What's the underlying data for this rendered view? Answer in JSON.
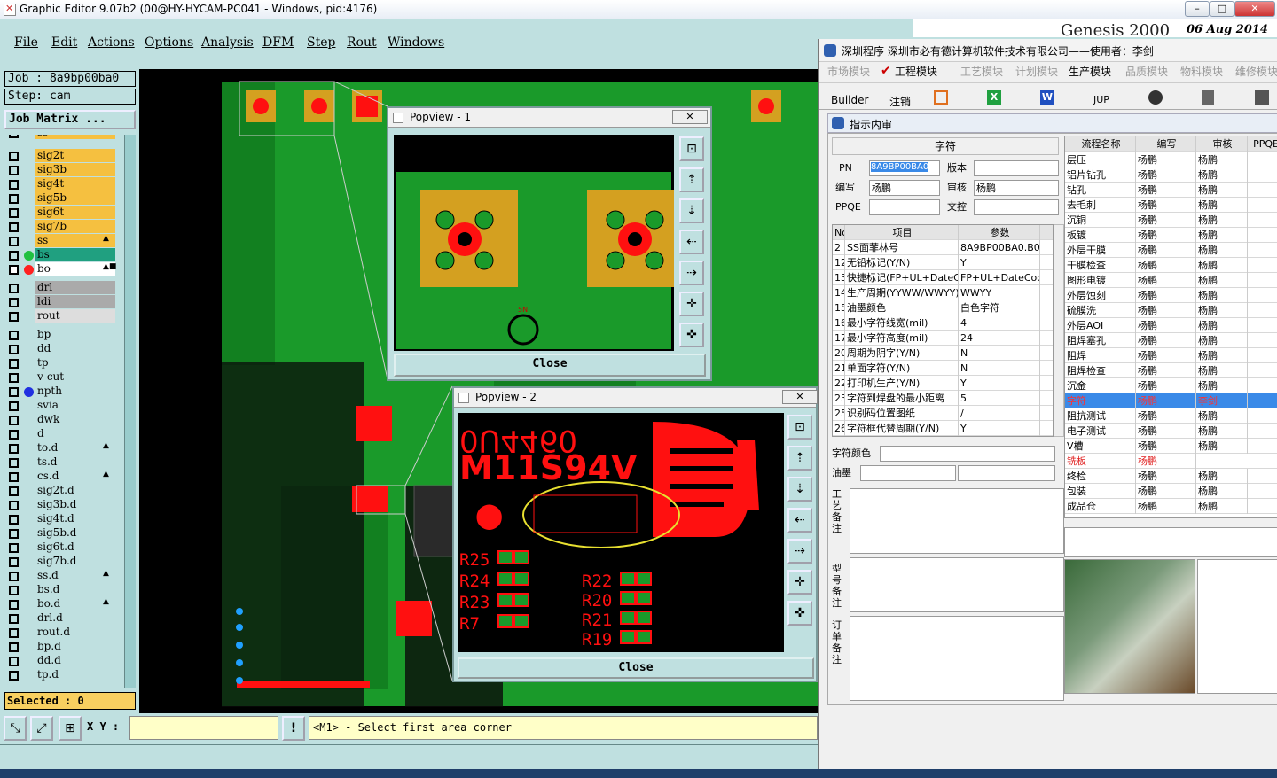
{
  "app": {
    "title": "Graphic Editor 9.07b2 (00@HY-HYCAM-PC041 - Windows, pid:4176)",
    "genesis": "Genesis 2000",
    "date": "06 Aug 2014"
  },
  "menu": [
    "File",
    "Edit",
    "Actions",
    "Options",
    "Analysis",
    "DFM",
    "Step",
    "Rout",
    "Windows"
  ],
  "job": {
    "job": "Job : 8a9bp00ba0",
    "step": "Step: cam",
    "matrix": "Job Matrix ..."
  },
  "layers": [
    {
      "n": "ss",
      "c": "#f5c040",
      "a": "▲"
    },
    {
      "n": "sig2t",
      "c": "#f5c040"
    },
    {
      "n": "sig3b",
      "c": "#f5c040"
    },
    {
      "n": "sig4t",
      "c": "#f5c040"
    },
    {
      "n": "sig5b",
      "c": "#f5c040"
    },
    {
      "n": "sig6t",
      "c": "#f5c040"
    },
    {
      "n": "sig7b",
      "c": "#f5c040"
    },
    {
      "n": "ss",
      "c": "#f5c040",
      "a": "▲"
    },
    {
      "n": "bs",
      "c": "#20a080",
      "dot": "#20c040"
    },
    {
      "n": "bo",
      "c": "#ffffff",
      "dot": "#ff2020",
      "a": "▲■",
      "sel": true
    },
    {
      "n": "drl",
      "c": "#aaa",
      "gap": true
    },
    {
      "n": "ldi",
      "c": "#aaa"
    },
    {
      "n": "rout",
      "c": "#ddd"
    },
    {
      "n": "bp",
      "c": "#bfe0e0",
      "gap": true
    },
    {
      "n": "dd",
      "c": "#bfe0e0"
    },
    {
      "n": "tp",
      "c": "#bfe0e0"
    },
    {
      "n": "v-cut",
      "c": "#bfe0e0"
    },
    {
      "n": "npth",
      "c": "#bfe0e0",
      "dot": "#2030e0"
    },
    {
      "n": "svia",
      "c": "#bfe0e0"
    },
    {
      "n": "dwk",
      "c": "#bfe0e0"
    },
    {
      "n": "d",
      "c": "#bfe0e0"
    },
    {
      "n": "to.d",
      "c": "#bfe0e0",
      "a": "▲"
    },
    {
      "n": "ts.d",
      "c": "#bfe0e0"
    },
    {
      "n": "cs.d",
      "c": "#bfe0e0",
      "a": "▲"
    },
    {
      "n": "sig2t.d",
      "c": "#bfe0e0"
    },
    {
      "n": "sig3b.d",
      "c": "#bfe0e0"
    },
    {
      "n": "sig4t.d",
      "c": "#bfe0e0"
    },
    {
      "n": "sig5b.d",
      "c": "#bfe0e0"
    },
    {
      "n": "sig6t.d",
      "c": "#bfe0e0"
    },
    {
      "n": "sig7b.d",
      "c": "#bfe0e0"
    },
    {
      "n": "ss.d",
      "c": "#bfe0e0",
      "a": "▲"
    },
    {
      "n": "bs.d",
      "c": "#bfe0e0"
    },
    {
      "n": "bo.d",
      "c": "#bfe0e0",
      "a": "▲"
    },
    {
      "n": "drl.d",
      "c": "#bfe0e0"
    },
    {
      "n": "rout.d",
      "c": "#bfe0e0"
    },
    {
      "n": "bp.d",
      "c": "#bfe0e0"
    },
    {
      "n": "dd.d",
      "c": "#bfe0e0"
    },
    {
      "n": "tp.d",
      "c": "#bfe0e0"
    }
  ],
  "selected": "Selected : 0",
  "xy_label": "X Y :",
  "prompt": "<M1> - Select first area corner",
  "popview1": {
    "title": "Popview - 1",
    "close": "Close",
    "mark": "5N"
  },
  "popview2": {
    "title": "Popview - 2",
    "close": "Close",
    "text1": "0U4460",
    "text2": "M11S94V",
    "labels_l": [
      "R25",
      "R24",
      "R23",
      "R7"
    ],
    "labels_r": [
      "R22",
      "R20",
      "R21",
      "R19"
    ]
  },
  "right": {
    "title": "深圳程序   深圳市必有德计算机软件技术有限公司——使用者：李剑",
    "tabs": [
      "市场模块",
      "工程模块",
      "工艺模块",
      "计划模块",
      "生产模块",
      "品质模块",
      "物料模块",
      "维修模块"
    ],
    "toolbar": [
      "Builder",
      "注销",
      "JUP"
    ],
    "subtitle": "指示内审",
    "form": {
      "header": "字符",
      "pn_label": "PN",
      "pn_value": "8A9BP00BA0",
      "ver_label": "版本",
      "ver_value": "",
      "writer_label": "编写",
      "writer_value": "杨鹏",
      "audit_label": "审核",
      "audit_value": "杨鹏",
      "ppqe_label": "PPQE",
      "ppqe_value": "",
      "control_label": "文控",
      "control_value": ""
    },
    "params_hdr": [
      "No",
      "项目",
      "参数"
    ],
    "params": [
      [
        "2",
        "SS面菲林号",
        "8A9BP00BA0.B0"
      ],
      [
        "12",
        "无铅标记(Y/N)",
        "Y"
      ],
      [
        "13",
        "快捷标记(FP+UL+DateCo",
        "FP+UL+DateCode"
      ],
      [
        "14",
        "生产周期(YYWW/WWYY)",
        "WWYY"
      ],
      [
        "15",
        "油墨颜色",
        "白色字符"
      ],
      [
        "16",
        "最小字符线宽(mil)",
        "4"
      ],
      [
        "17",
        "最小字符高度(mil)",
        "24"
      ],
      [
        "20",
        "周期为阴字(Y/N)",
        "N"
      ],
      [
        "21",
        "单面字符(Y/N)",
        "N"
      ],
      [
        "22",
        "打印机生产(Y/N)",
        "Y"
      ],
      [
        "23",
        "字符到焊盘的最小距离",
        "5"
      ],
      [
        "25",
        "识别码位置图纸",
        "/"
      ],
      [
        "26",
        "字符框代替周期(Y/N)",
        "Y"
      ]
    ],
    "color_label": "字符颜色",
    "ink_label": "油墨",
    "notes": [
      "工艺备注",
      "型号备注",
      "订单备注"
    ],
    "flow_hdr": [
      "流程名称",
      "编写",
      "审核",
      "PPQE"
    ],
    "flow": [
      [
        "层压",
        "杨鹏",
        "杨鹏"
      ],
      [
        "铝片钻孔",
        "杨鹏",
        "杨鹏"
      ],
      [
        "钻孔",
        "杨鹏",
        "杨鹏"
      ],
      [
        "去毛刺",
        "杨鹏",
        "杨鹏"
      ],
      [
        "沉铜",
        "杨鹏",
        "杨鹏"
      ],
      [
        "板镀",
        "杨鹏",
        "杨鹏"
      ],
      [
        "外层干膜",
        "杨鹏",
        "杨鹏"
      ],
      [
        "干膜检查",
        "杨鹏",
        "杨鹏"
      ],
      [
        "图形电镀",
        "杨鹏",
        "杨鹏"
      ],
      [
        "外层蚀刻",
        "杨鹏",
        "杨鹏"
      ],
      [
        "硫膜洗",
        "杨鹏",
        "杨鹏"
      ],
      [
        "外层AOI",
        "杨鹏",
        "杨鹏"
      ],
      [
        "阻焊塞孔",
        "杨鹏",
        "杨鹏"
      ],
      [
        "阻焊",
        "杨鹏",
        "杨鹏"
      ],
      [
        "阻焊检查",
        "杨鹏",
        "杨鹏"
      ],
      [
        "沉金",
        "杨鹏",
        "杨鹏"
      ],
      [
        "字符",
        "杨鹏",
        "李剑"
      ],
      [
        "阻抗测试",
        "杨鹏",
        "杨鹏"
      ],
      [
        "电子测试",
        "杨鹏",
        "杨鹏"
      ],
      [
        "V槽",
        "杨鹏",
        "杨鹏"
      ],
      [
        "铣板",
        "杨鹏",
        ""
      ],
      [
        "终检",
        "杨鹏",
        "杨鹏"
      ],
      [
        "包装",
        "杨鹏",
        "杨鹏"
      ],
      [
        "成品仓",
        "杨鹏",
        "杨鹏"
      ]
    ]
  },
  "colors": {
    "bg": "#bfe0e0",
    "board_green": "#1a9a2a",
    "pad_yellow": "#d4a020",
    "copper_red": "#ff1010",
    "highlight": "#3a8ae8"
  }
}
